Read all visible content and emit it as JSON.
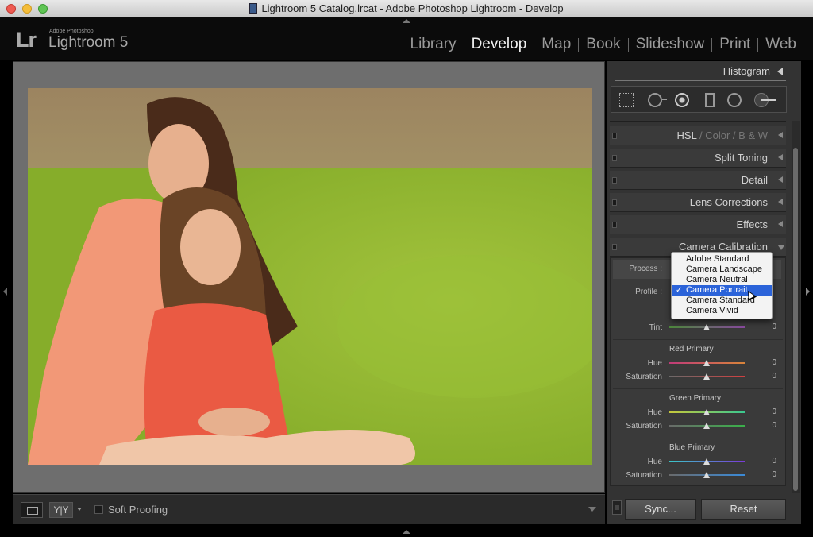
{
  "window": {
    "title": "Lightroom 5 Catalog.lrcat - Adobe Photoshop Lightroom - Develop"
  },
  "brand": {
    "logo": "Lr",
    "adobe": "Adobe Photoshop",
    "name": "Lightroom 5"
  },
  "modules": [
    {
      "label": "Library",
      "active": false
    },
    {
      "label": "Develop",
      "active": true
    },
    {
      "label": "Map",
      "active": false
    },
    {
      "label": "Book",
      "active": false
    },
    {
      "label": "Slideshow",
      "active": false
    },
    {
      "label": "Print",
      "active": false
    },
    {
      "label": "Web",
      "active": false
    }
  ],
  "toolbar": {
    "yy_label": "Y|Y",
    "soft_proofing": "Soft Proofing"
  },
  "right_panel": {
    "histogram": "Histogram",
    "hsl": {
      "hsl": "HSL",
      "sep1": "/",
      "color": "Color",
      "sep2": "/",
      "bw": "B & W"
    },
    "split_toning": "Split Toning",
    "detail": "Detail",
    "lens_corrections": "Lens Corrections",
    "effects": "Effects",
    "camera_calibration": "Camera Calibration",
    "calibration": {
      "process_label": "Process :",
      "profile_label": "Profile :",
      "tint": {
        "label": "Tint",
        "value": "0"
      },
      "red_primary": {
        "title": "Red Primary",
        "hue_label": "Hue",
        "hue": "0",
        "sat_label": "Saturation",
        "sat": "0"
      },
      "green_primary": {
        "title": "Green Primary",
        "hue_label": "Hue",
        "hue": "0",
        "sat_label": "Saturation",
        "sat": "0"
      },
      "blue_primary": {
        "title": "Blue Primary",
        "hue_label": "Hue",
        "hue": "0",
        "sat_label": "Saturation",
        "sat": "0"
      }
    },
    "profile_dropdown": {
      "options": [
        "Adobe Standard",
        "Camera Landscape",
        "Camera Neutral",
        "Camera Portrait",
        "Camera Standard",
        "Camera Vivid"
      ],
      "selected": "Camera Portrait",
      "check": "✓"
    },
    "sync": "Sync...",
    "reset": "Reset"
  },
  "colors": {
    "selection": "#2b63d9",
    "background": "#333333",
    "active_module": "#f1f1f1"
  }
}
